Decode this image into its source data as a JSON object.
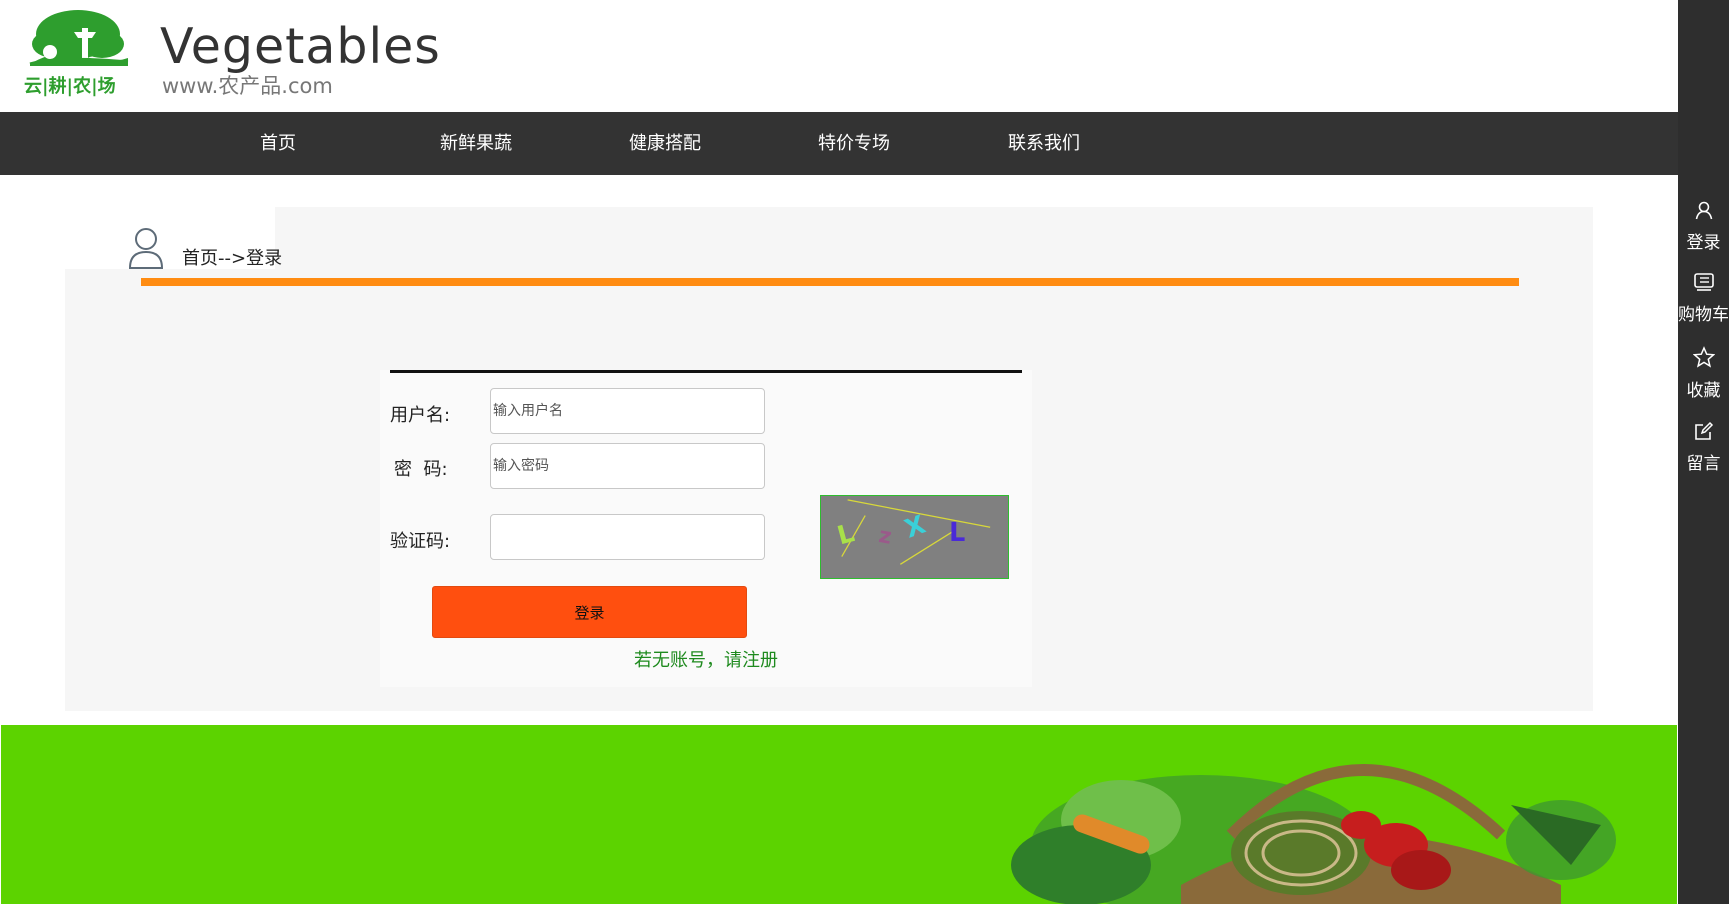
{
  "header": {
    "logo_text": "云|耕|农|场",
    "brand_title": "Vegetables",
    "brand_url": "www.农产品.com"
  },
  "nav": {
    "items": [
      "首页",
      "新鲜果蔬",
      "健康搭配",
      "特价专场",
      "联系我们"
    ]
  },
  "sidebar": {
    "items": [
      {
        "label": "登录",
        "icon": "user-icon"
      },
      {
        "label": "购物车",
        "icon": "cart-icon"
      },
      {
        "label": "收藏",
        "icon": "star-icon"
      },
      {
        "label": "留言",
        "icon": "edit-icon"
      }
    ]
  },
  "breadcrumb": {
    "text": "首页-->登录"
  },
  "login_form": {
    "username_label": "用户名:",
    "username_placeholder": "输入用户名",
    "password_label": "密  码:",
    "password_placeholder": "输入密码",
    "captcha_label": "验证码:",
    "captcha_value": "",
    "captcha_chars": [
      "L",
      "z",
      "X",
      "L"
    ],
    "login_button": "登录",
    "register_link": "若无账号，请注册"
  },
  "colors": {
    "nav_bg": "#333333",
    "accent_orange": "#ff8c12",
    "button": "#ff4f0f",
    "footer_green": "#5cd300",
    "link_green": "#1e8a1e"
  }
}
